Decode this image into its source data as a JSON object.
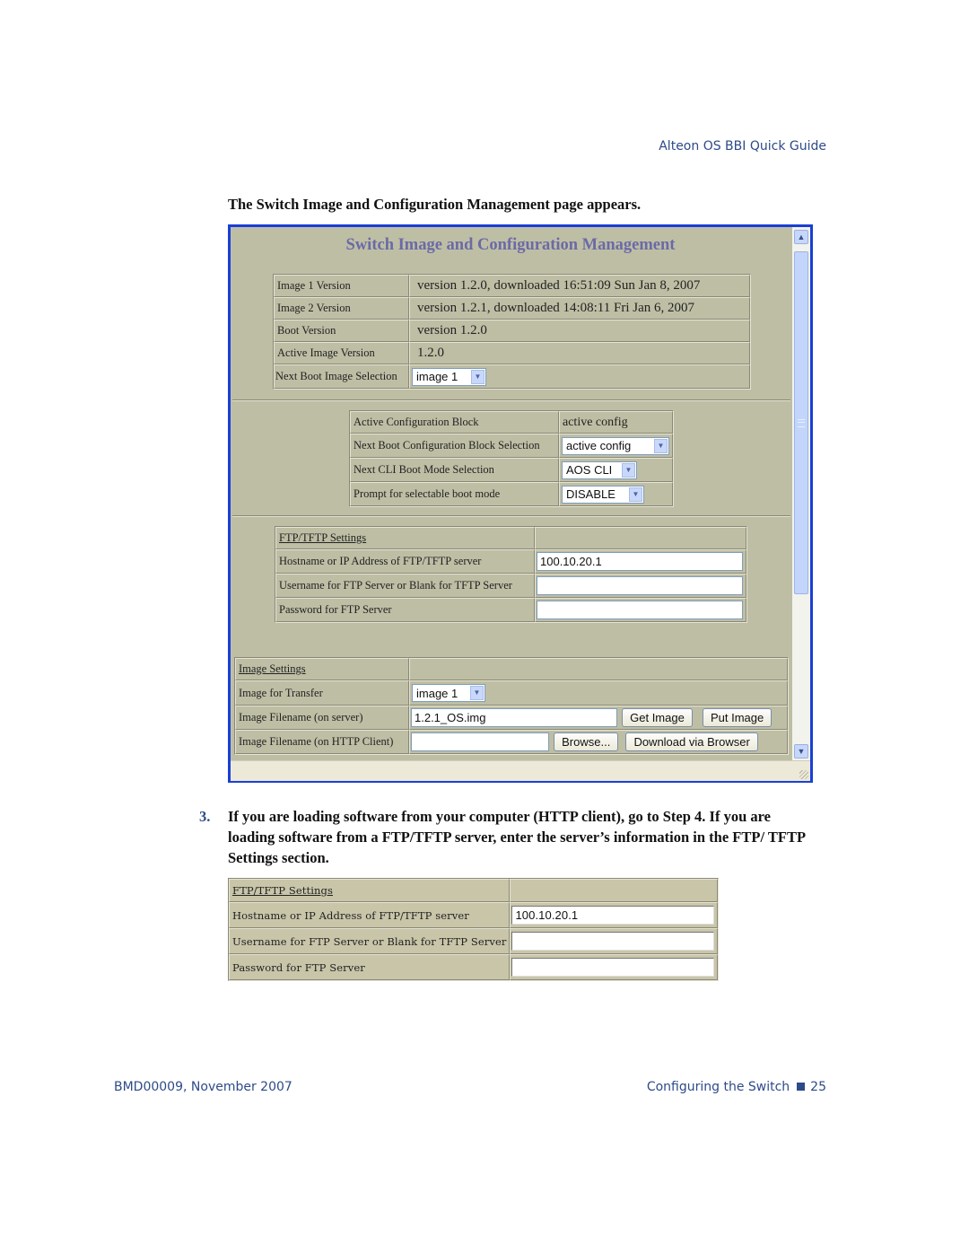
{
  "header": {
    "guide_title": "Alteon OS  BBI Quick Guide"
  },
  "intro_text": "The Switch Image and Configuration Management page appears.",
  "browser": {
    "page_title": "Switch Image and Configuration Management",
    "image_table": {
      "rows": [
        {
          "label": "Image 1 Version",
          "value": "version 1.2.0, downloaded 16:51:09 Sun Jan 8, 2007"
        },
        {
          "label": "Image 2 Version",
          "value": "version 1.2.1, downloaded 14:08:11 Fri Jan 6, 2007"
        },
        {
          "label": "Boot Version",
          "value": "version 1.2.0"
        },
        {
          "label": "Active Image Version",
          "value": "1.2.0"
        }
      ],
      "next_boot_label": "Next Boot Image Selection",
      "next_boot_value": "image 1"
    },
    "config_table": {
      "active_block_label": "Active Configuration Block",
      "active_block_value": "active config",
      "next_boot_config_label": "Next Boot Configuration Block Selection",
      "next_boot_config_value": "active config",
      "next_cli_label": "Next CLI Boot Mode Selection",
      "next_cli_value": "AOS CLI",
      "prompt_label": "Prompt for selectable boot mode",
      "prompt_value": "DISABLE"
    },
    "ftp_table": {
      "header": "FTP/TFTP Settings",
      "host_label": "Hostname or IP Address of FTP/TFTP server",
      "host_value": "100.10.20.1",
      "user_label": "Username for FTP Server or Blank for TFTP Server",
      "user_value": "",
      "pass_label": "Password for FTP Server",
      "pass_value": ""
    },
    "image_settings": {
      "header": "Image Settings",
      "transfer_label": "Image for Transfer",
      "transfer_value": "image 1",
      "server_file_label": "Image Filename (on server)",
      "server_file_value": "1.2.1_OS.img",
      "get_button": "Get Image",
      "put_button": "Put Image",
      "client_file_label": "Image Filename (on HTTP Client)",
      "client_file_value": "",
      "browse_button": "Browse...",
      "download_button": "Download via Browser"
    }
  },
  "step": {
    "number": "3.",
    "text": "If you are loading software from your computer (HTTP client), go to Step 4. If you are loading software from a FTP/TFTP server, enter the server’s information in the FTP/ TFTP Settings section."
  },
  "inset_ftp": {
    "header": "FTP/TFTP Settings",
    "host_label": "Hostname or IP Address of FTP/TFTP server",
    "host_value": "100.10.20.1",
    "user_label": "Username for FTP Server or Blank for TFTP Server",
    "user_value": "",
    "pass_label": "Password for FTP Server",
    "pass_value": ""
  },
  "footer": {
    "doc_id": "BMD00009, November 2007",
    "section": "Configuring the Switch",
    "page_number": "25"
  }
}
